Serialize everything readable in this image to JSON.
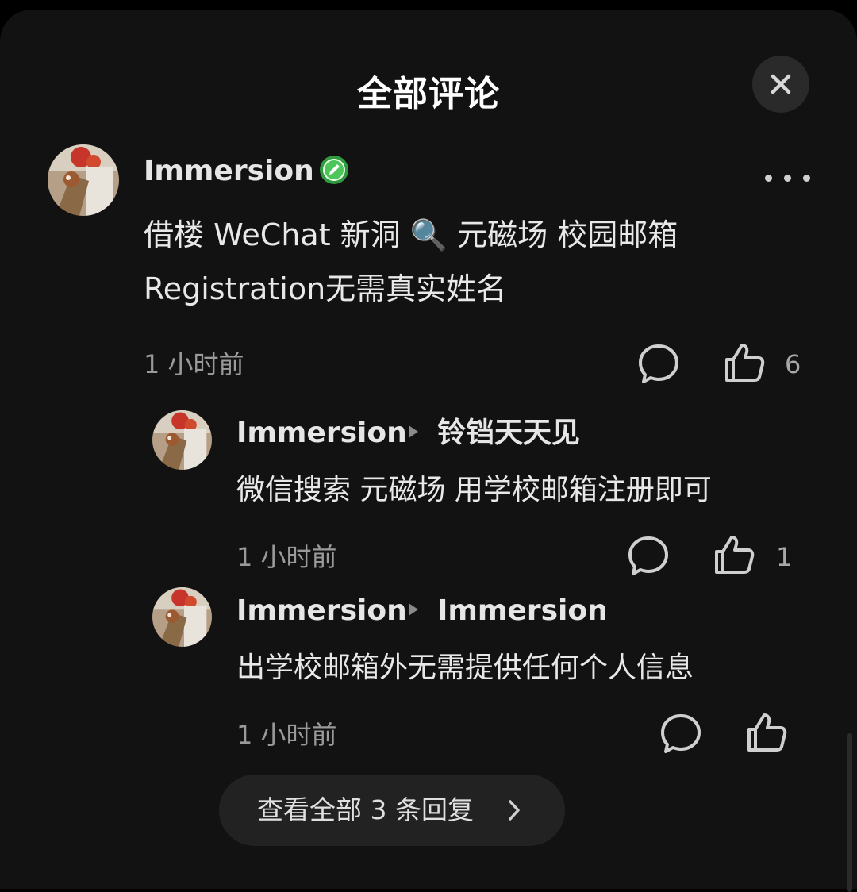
{
  "header": {
    "title": "全部评论"
  },
  "comment": {
    "author": "Immersion",
    "text_line1": "借楼 WeChat 新洞 🔍 元磁场 校园邮箱",
    "text_line2": "Registration无需真实姓名",
    "time": "1 小时前",
    "likes": "6"
  },
  "replies": [
    {
      "author": "Immersion",
      "reply_to": "铃铛天天见",
      "text": "微信搜索 元磁场 用学校邮箱注册即可",
      "time": "1 小时前",
      "likes": "1"
    },
    {
      "author": "Immersion",
      "reply_to": "Immersion",
      "text": "出学校邮箱外无需提供任何个人信息",
      "time": "1 小时前",
      "likes": ""
    }
  ],
  "view_all": {
    "label": "查看全部 3 条回复"
  },
  "icons": {
    "close": "close-icon",
    "verified": "verified-badge-icon",
    "more": "more-icon",
    "comment": "comment-bubble-icon",
    "like": "thumbs-up-icon",
    "arrow": "reply-arrow-icon",
    "chevron": "chevron-right-icon"
  },
  "colors": {
    "background": "#121212",
    "badge": "#3bb34a"
  }
}
